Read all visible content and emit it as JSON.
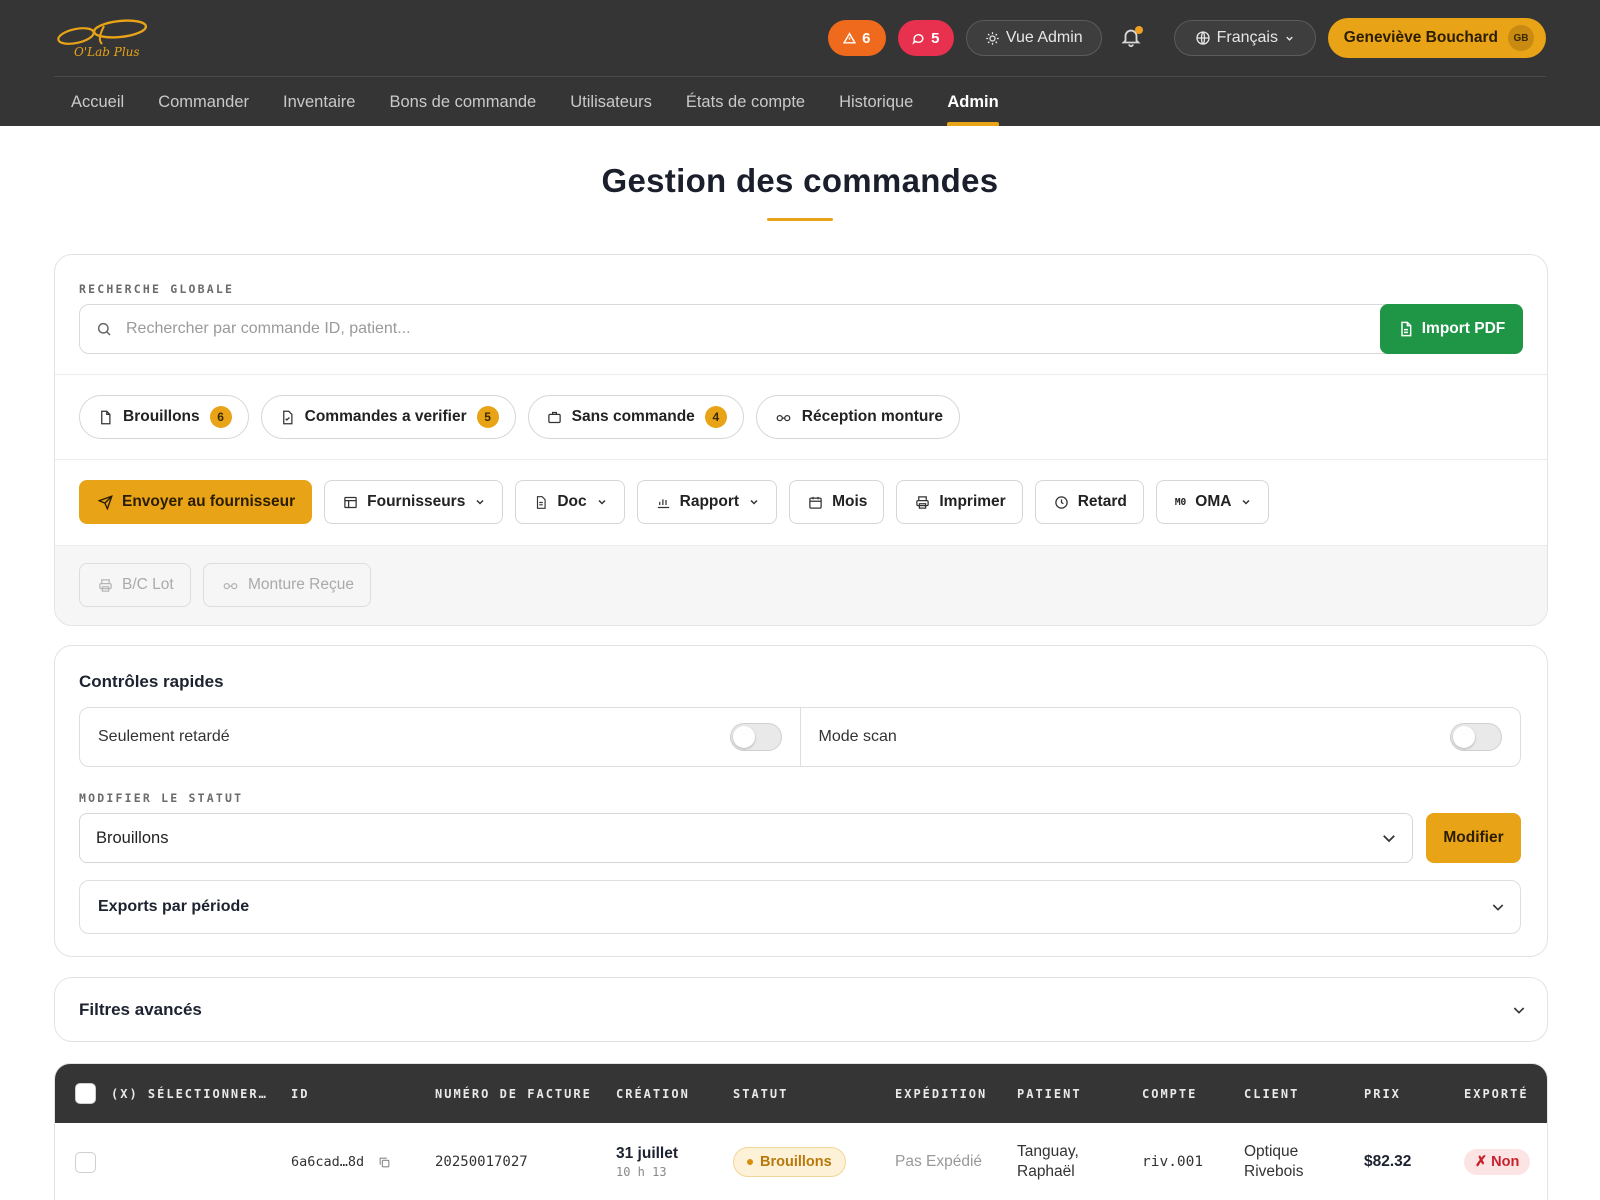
{
  "header": {
    "logo_text": "O'Lab Plus",
    "alerts_count": "6",
    "messages_count": "5",
    "vue_admin": "Vue Admin",
    "language": "Français",
    "user_name": "Geneviève Bouchard",
    "user_initials": "GB",
    "colors": {
      "bar": "#353535",
      "accent": "#e8a317",
      "alert": "#f06a1e",
      "message": "#e8304f"
    }
  },
  "nav": {
    "items": [
      "Accueil",
      "Commander",
      "Inventaire",
      "Bons de commande",
      "Utilisateurs",
      "États de compte",
      "Historique",
      "Admin"
    ],
    "active": "Admin"
  },
  "page": {
    "title": "Gestion des commandes"
  },
  "search": {
    "label": "RECHERCHE GLOBALE",
    "placeholder": "Rechercher par commande ID, patient...",
    "value": "",
    "import_label": "Import PDF"
  },
  "chips": [
    {
      "label": "Brouillons",
      "count": "6",
      "icon": "file-icon"
    },
    {
      "label": "Commandes a verifier",
      "count": "5",
      "icon": "file-check-icon"
    },
    {
      "label": "Sans commande",
      "count": "4",
      "icon": "briefcase-icon"
    },
    {
      "label": "Réception monture",
      "icon": "glasses-icon"
    }
  ],
  "actions": {
    "send": "Envoyer au fournisseur",
    "suppliers": "Fournisseurs",
    "doc": "Doc",
    "report": "Rapport",
    "month": "Mois",
    "print": "Imprimer",
    "delay": "Retard",
    "oma": "OMA",
    "oma_icon_text": "M0",
    "bc_lot": "B/C Lot",
    "frame_received": "Monture Reçue"
  },
  "quick": {
    "title": "Contrôles rapides",
    "only_late": "Seulement retardé",
    "only_late_on": false,
    "scan_mode": "Mode scan",
    "scan_mode_on": false,
    "status_label": "MODIFIER LE STATUT",
    "status_value": "Brouillons",
    "modify": "Modifier",
    "exports": "Exports par période"
  },
  "filters": {
    "title": "Filtres avancés"
  },
  "table": {
    "columns": [
      "(X) SÉLECTIONNER…",
      "ID",
      "NUMÉRO DE FACTURE",
      "CRÉATION",
      "STATUT",
      "EXPÉDITION",
      "PATIENT",
      "COMPTE",
      "CLIENT",
      "PRIX",
      "EXPORTÉ"
    ],
    "rows": [
      {
        "id": "6a6cad…8d",
        "invoice": "20250017027",
        "created_date": "31 juillet",
        "created_time": "10 h 13",
        "status": "Brouillons",
        "shipping": "Pas Expédié",
        "patient_line1": "Tanguay,",
        "patient_line2": "Raphaël",
        "account": "riv.001",
        "client_line1": "Optique",
        "client_line2": "Rivebois",
        "price": "$82.32",
        "exported": "✗ Non"
      }
    ]
  }
}
